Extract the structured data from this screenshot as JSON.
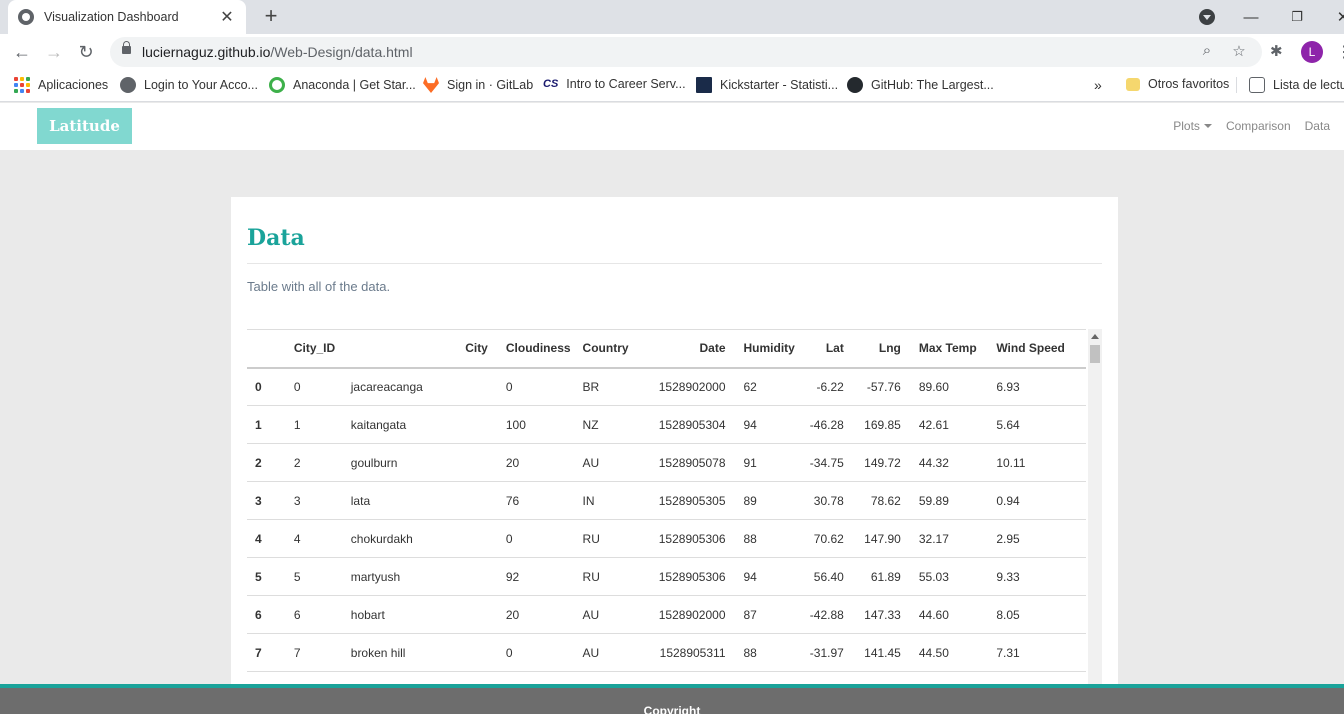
{
  "browser": {
    "tab_title": "Visualization Dashboard",
    "url_domain": "luciernaguz.github.io",
    "url_path": "/Web-Design/data.html",
    "profile_initial": "L"
  },
  "bookmarks": {
    "items": [
      {
        "label": "Aplicaciones",
        "icon": "apps-grid-icon"
      },
      {
        "label": "Login to Your Acco...",
        "icon": "globe-icon"
      },
      {
        "label": "Anaconda | Get Star...",
        "icon": "anaconda-icon"
      },
      {
        "label": "Sign in · GitLab",
        "icon": "gitlab-icon"
      },
      {
        "label": "Intro to Career Serv...",
        "icon": "cs-icon"
      },
      {
        "label": "Kickstarter - Statisti...",
        "icon": "kickstarter-icon"
      },
      {
        "label": "GitHub: The Largest...",
        "icon": "github-icon"
      }
    ],
    "overflow": "»",
    "other_favorites": "Otros favoritos",
    "reading_list": "Lista de lectura"
  },
  "site": {
    "brand": "Latitude",
    "nav": {
      "plots": "Plots",
      "comparison": "Comparison",
      "data": "Data"
    },
    "heading": "Data",
    "description": "Table with all of the data.",
    "footer": "Copyright"
  },
  "colors": {
    "accent": "#1aa39a",
    "brand_bg": "#81d8d0",
    "footer_bg": "#6d6d6d"
  },
  "table": {
    "headers": [
      "",
      "City_ID",
      "City",
      "Cloudiness",
      "Country",
      "Date",
      "Humidity",
      "Lat",
      "Lng",
      "Max Temp",
      "Wind Speed"
    ],
    "rows": [
      [
        "0",
        "0",
        "jacareacanga",
        "0",
        "BR",
        "1528902000",
        "62",
        "-6.22",
        "-57.76",
        "89.60",
        "6.93"
      ],
      [
        "1",
        "1",
        "kaitangata",
        "100",
        "NZ",
        "1528905304",
        "94",
        "-46.28",
        "169.85",
        "42.61",
        "5.64"
      ],
      [
        "2",
        "2",
        "goulburn",
        "20",
        "AU",
        "1528905078",
        "91",
        "-34.75",
        "149.72",
        "44.32",
        "10.11"
      ],
      [
        "3",
        "3",
        "lata",
        "76",
        "IN",
        "1528905305",
        "89",
        "30.78",
        "78.62",
        "59.89",
        "0.94"
      ],
      [
        "4",
        "4",
        "chokurdakh",
        "0",
        "RU",
        "1528905306",
        "88",
        "70.62",
        "147.90",
        "32.17",
        "2.95"
      ],
      [
        "5",
        "5",
        "martyush",
        "92",
        "RU",
        "1528905306",
        "94",
        "56.40",
        "61.89",
        "55.03",
        "9.33"
      ],
      [
        "6",
        "6",
        "hobart",
        "20",
        "AU",
        "1528902000",
        "87",
        "-42.88",
        "147.33",
        "44.60",
        "8.05"
      ],
      [
        "7",
        "7",
        "broken hill",
        "0",
        "AU",
        "1528905311",
        "88",
        "-31.97",
        "141.45",
        "44.50",
        "7.31"
      ]
    ]
  }
}
